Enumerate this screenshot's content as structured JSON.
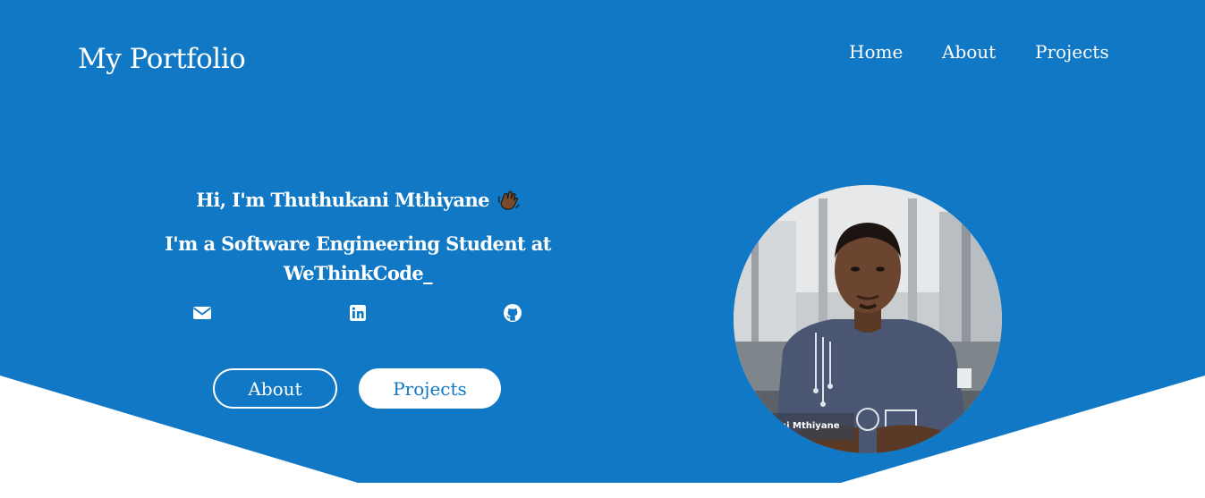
{
  "colors": {
    "hero_background": "#1078c5",
    "text": "#ffffff",
    "page_background": "#ffffff",
    "projects_button_text": "#1078c5"
  },
  "navbar": {
    "brand": "My Portfolio",
    "links": [
      {
        "label": "Home"
      },
      {
        "label": "About"
      },
      {
        "label": "Projects"
      }
    ]
  },
  "hero": {
    "greeting": "Hi, I'm Thuthukani Mthiyane",
    "greeting_emoji_icon": "waving-hand-icon",
    "tagline": "I'm a Software Engineering Student at WeThinkCode_",
    "socials": [
      {
        "icon": "email-icon"
      },
      {
        "icon": "linkedin-icon"
      },
      {
        "icon": "github-icon"
      }
    ],
    "buttons": {
      "about_label": "About",
      "projects_label": "Projects"
    },
    "portrait": {
      "caption": "ni Mthiyane"
    }
  }
}
